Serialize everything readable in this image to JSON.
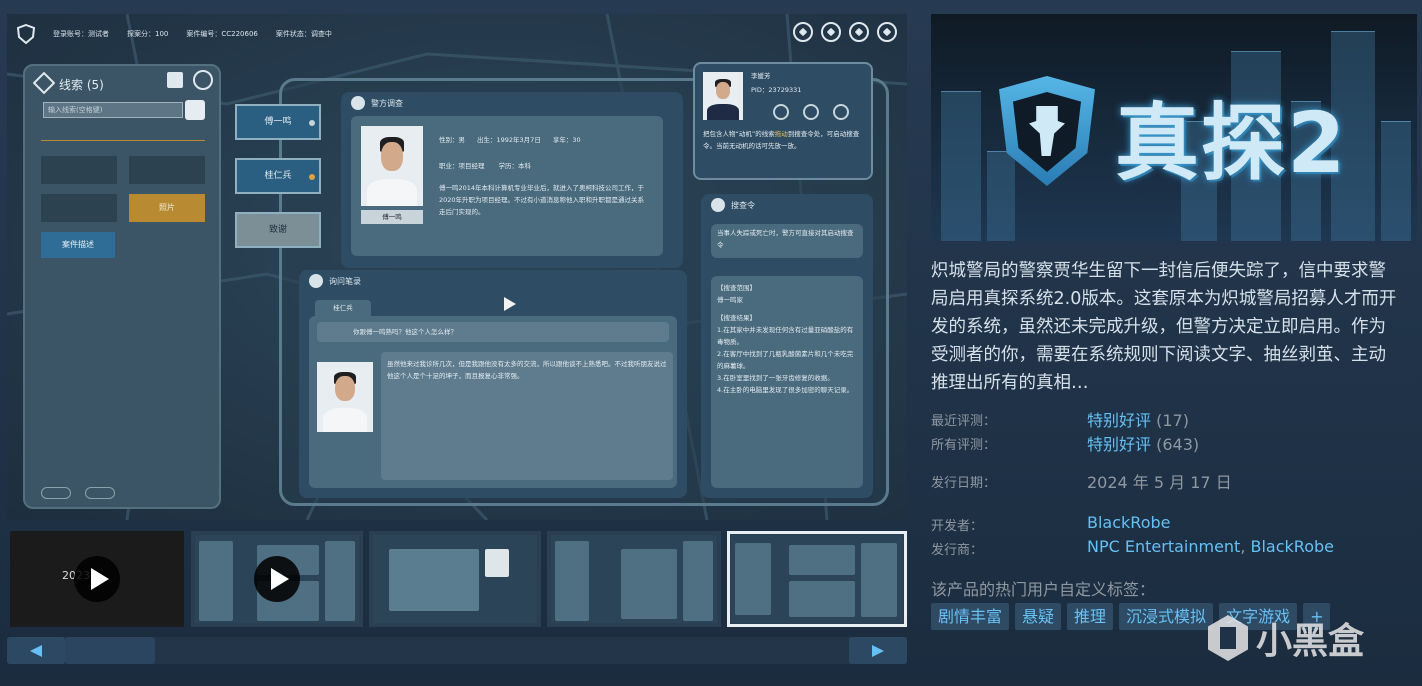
{
  "game_screen": {
    "top_info": [
      "登录账号：测试者",
      "探案分：100",
      "案件编号：CC220606",
      "案件状态：调查中"
    ],
    "clues": {
      "title": "线索 (5)",
      "search_placeholder": "输入线索(空格键)",
      "photo_label": "照片",
      "case_desc_label": "案件描述"
    },
    "side_buttons": [
      "傅一鸣",
      "桂仁兵",
      "致谢"
    ],
    "police_panel": {
      "title": "警方调查",
      "fields": [
        "性别：男",
        "出生：1992年3月7日",
        "享年：30",
        "职业：项目经理",
        "学历：本科"
      ],
      "name": "傅一鸣",
      "bio": "傅一鸣2014年本科计算机专业毕业后，就进入了奥柯科技公司工作，于2020年升职为项目经理。不过有小道消息称他入职和升职都是通过关系走后门实现的。"
    },
    "inquiry_panel": {
      "title": "询问笔录",
      "tab": "桂仁兵",
      "question": "你跟傅一鸣熟吗？他这个人怎么样？",
      "answer": "虽然他来过我诊所几次，但是我跟他没有太多的交流，所以跟他谈不上熟悉吧。不过我听朋友说过他这个人是个十足的坤子，而且报复心非常强。"
    },
    "officer_card": {
      "name": "李媛芳",
      "pid": "PID：23729331",
      "message_pre": "把包含人物“动机”的线索",
      "message_hl": "拖动",
      "message_post": "到搜查令处，可启动搜查令。当前无动机的话可先放一放。"
    },
    "warrant_panel": {
      "title": "搜查令",
      "intro": "当事人失踪或死亡时，警方可直接对其启动搜查令",
      "scope_title": "【搜查范围】",
      "scope": "傅一鸣家",
      "result_title": "【搜查结果】",
      "results": [
        "1.在其家中并未发现任何含有过量亚硝酸盐的有毒物质。",
        "2.在客厅中找到了几瓶乳酸菌素片和几个未吃完的麻薯球。",
        "3.在卧室里找到了一张牙齿修复的收据。",
        "4.在主卧的电脑里发现了很多加密的聊天记录。"
      ]
    }
  },
  "thumbnails": {
    "year_text": "2023",
    "selected_index": 4,
    "video_indices": [
      0,
      1
    ]
  },
  "capsule": {
    "title": "真探2"
  },
  "description": "炽城警局的警察贾华生留下一封信后便失踪了，信中要求警局启用真探系统2.0版本。这套原本为炽城警局招募人才而开发的系统，虽然还未完成升级，但警方决定立即启用。作为受测者的你，需要在系统规则下阅读文字、抽丝剥茧、主动推理出所有的真相…",
  "reviews": {
    "recent_label": "最近评测：",
    "recent_value": "特别好评",
    "recent_count": "(17)",
    "all_label": "所有评测：",
    "all_value": "特别好评",
    "all_count": "(643)"
  },
  "release": {
    "label": "发行日期：",
    "date": "2024 年 5 月 17 日"
  },
  "developer": {
    "label": "开发者：",
    "name": "BlackRobe"
  },
  "publisher": {
    "label": "发行商：",
    "name1": "NPC Entertainment",
    "sep": ", ",
    "name2": "BlackRobe"
  },
  "tags": {
    "label": "该产品的热门用户自定义标签：",
    "items": [
      "剧情丰富",
      "悬疑",
      "推理",
      "沉浸式模拟",
      "文字游戏",
      "+"
    ]
  },
  "watermark": {
    "text": "小黑盒"
  },
  "colors": {
    "link": "#66c0f4",
    "label": "#8f98a0",
    "tag_bg": "#2f4a63",
    "accent_gold": "#b88b33"
  },
  "icons": [
    "shield-logo-icon",
    "settings-icon",
    "search-icon",
    "play-icon",
    "arrow-left-icon",
    "arrow-right-icon",
    "cursor-icon"
  ]
}
